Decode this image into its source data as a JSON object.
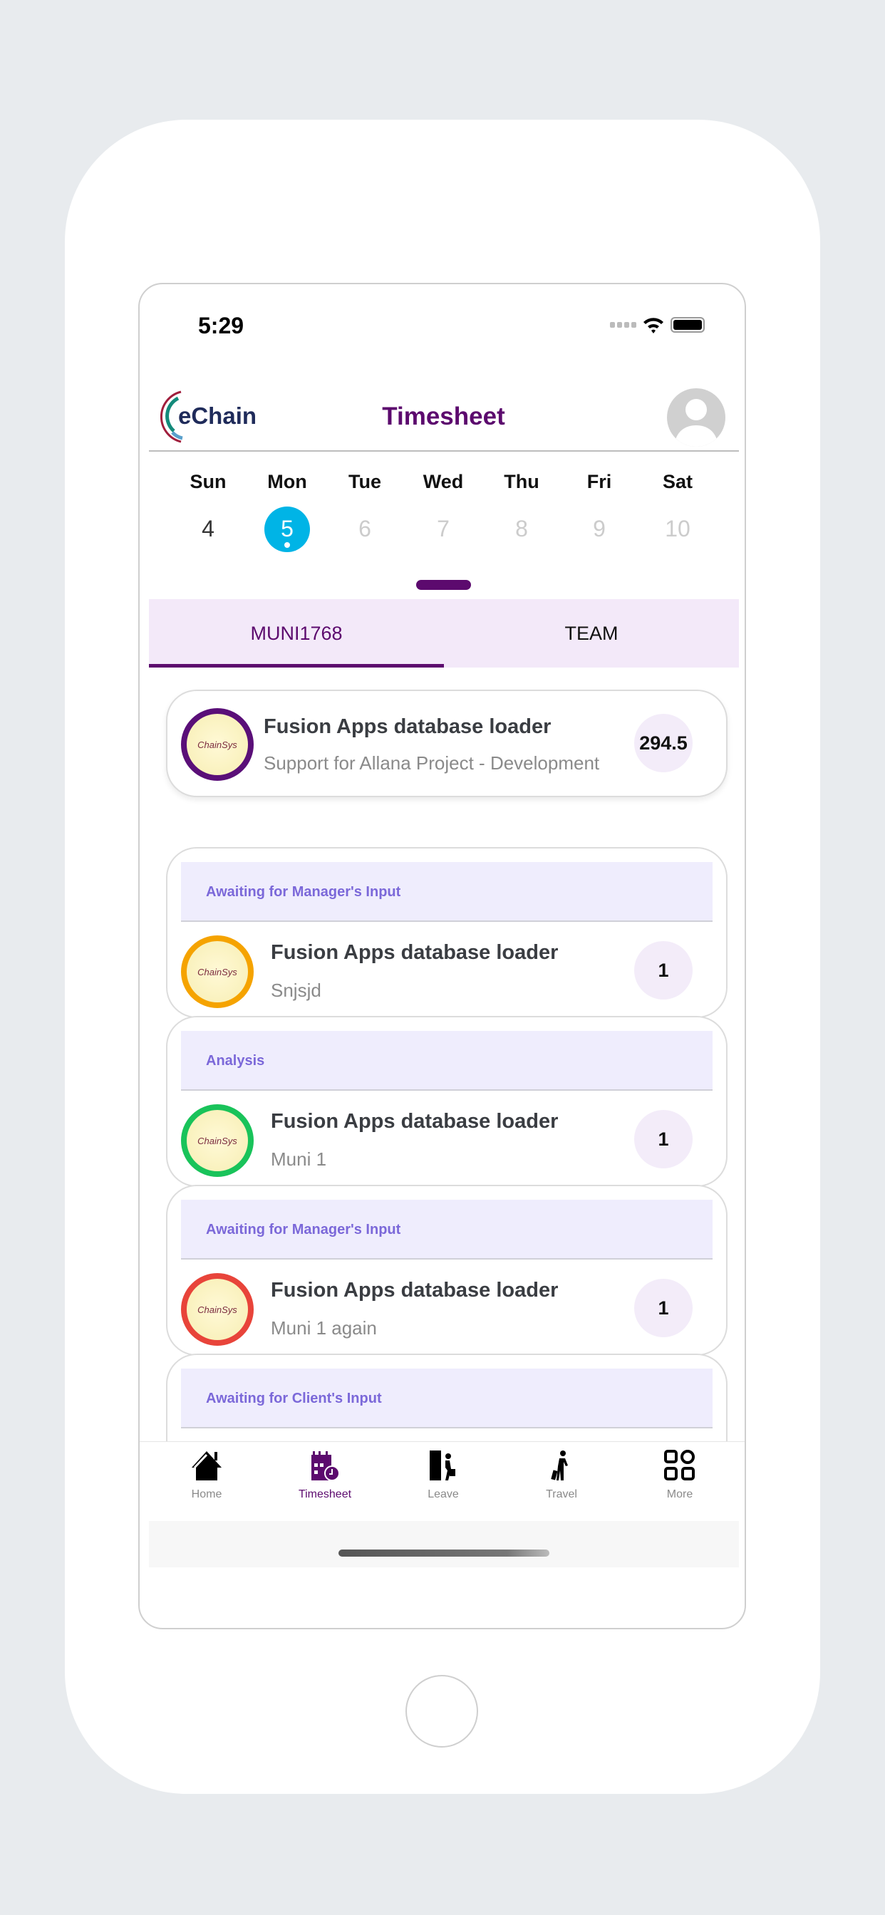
{
  "status_bar": {
    "time": "5:29"
  },
  "header": {
    "logo": "eChain",
    "title": "Timesheet",
    "avatar_icon": "user-avatar-icon"
  },
  "week": {
    "days": [
      {
        "name": "Sun",
        "num": "4"
      },
      {
        "name": "Mon",
        "num": "5",
        "selected": true
      },
      {
        "name": "Tue",
        "num": "6"
      },
      {
        "name": "Wed",
        "num": "7"
      },
      {
        "name": "Thu",
        "num": "8"
      },
      {
        "name": "Fri",
        "num": "9"
      },
      {
        "name": "Sat",
        "num": "10"
      }
    ]
  },
  "tabs": [
    {
      "label": "MUNI1768",
      "active": true
    },
    {
      "label": "TEAM"
    }
  ],
  "summary": {
    "logo": "ChainSys",
    "title": "Fusion Apps database loader",
    "subtitle": "Support for Allana Project - Development",
    "hours": "294.5",
    "ring_color": "#5a0f78"
  },
  "entries": [
    {
      "status": "Awaiting for Manager's Input",
      "title": "Fusion Apps database loader",
      "subtitle": "Snjsjd",
      "hours": "1",
      "ring_color": "#f5a300"
    },
    {
      "status": "Analysis",
      "title": "Fusion Apps database loader",
      "subtitle": "Muni 1",
      "hours": "1",
      "ring_color": "#19c35a"
    },
    {
      "status": "Awaiting for Manager's Input",
      "title": "Fusion Apps database loader",
      "subtitle": "Muni 1 again",
      "hours": "1",
      "ring_color": "#e8443a"
    },
    {
      "status": "Awaiting for Client's Input",
      "title": "",
      "subtitle": "",
      "hours": "",
      "ring_color": "#e0c400"
    }
  ],
  "nav": [
    {
      "label": "Home",
      "icon": "home-icon"
    },
    {
      "label": "Timesheet",
      "icon": "calendar-clock-icon",
      "active": true
    },
    {
      "label": "Leave",
      "icon": "leave-door-icon"
    },
    {
      "label": "Travel",
      "icon": "traveler-icon"
    },
    {
      "label": "More",
      "icon": "grid-icon"
    }
  ],
  "colors": {
    "accent": "#5c0a6e",
    "selected_day": "#00b4e6",
    "status_text": "#7b68d9"
  }
}
